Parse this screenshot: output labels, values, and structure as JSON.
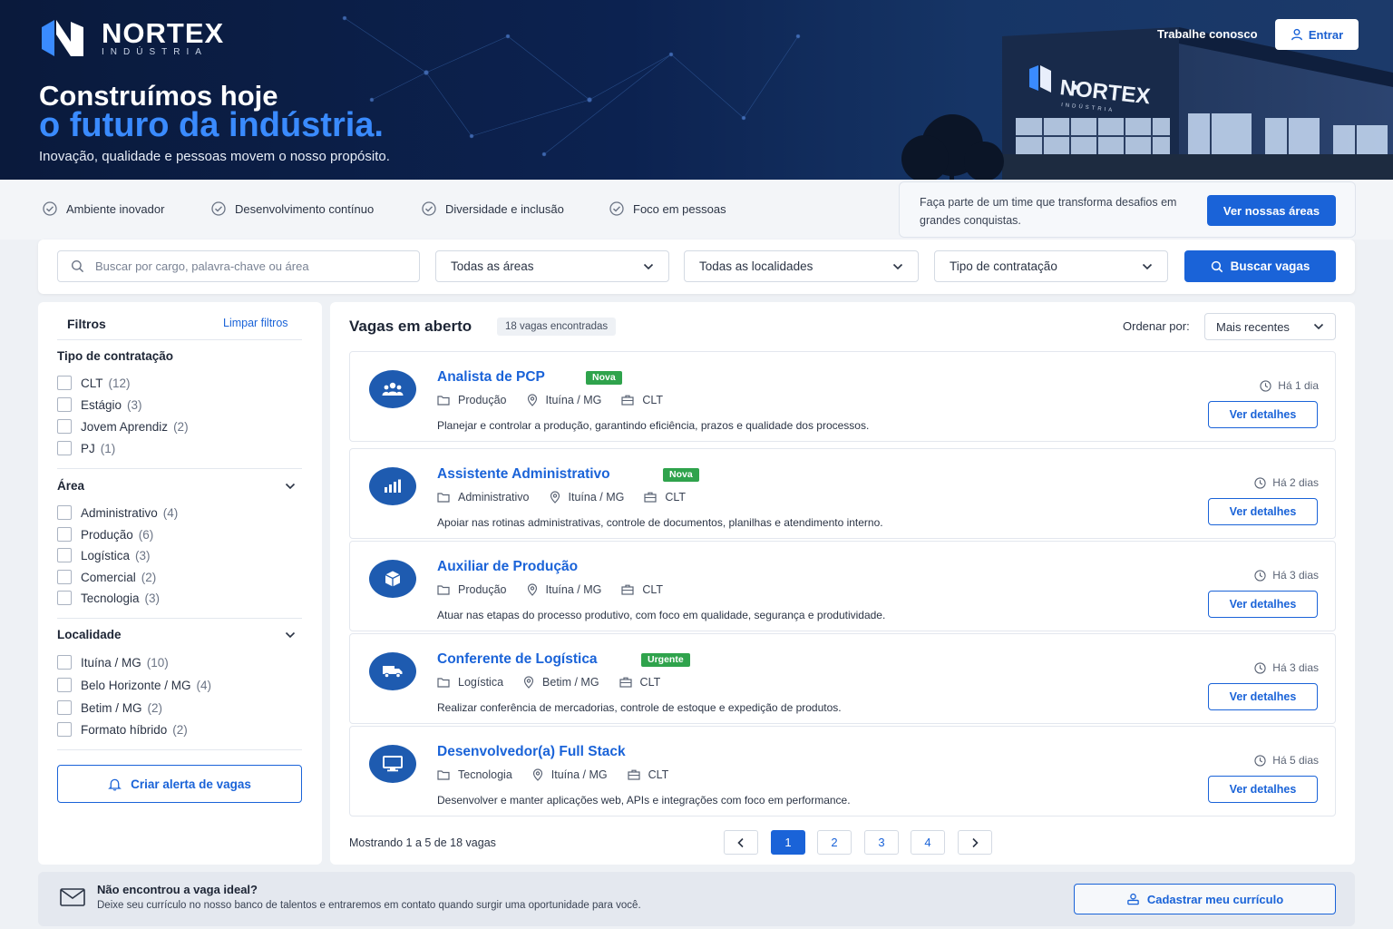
{
  "brand": {
    "name": "NORTEX",
    "sub": "INDÚSTRIA",
    "building_sign": "NORTEX",
    "building_sign_sub": "INDÚSTRIA"
  },
  "hero": {
    "line1": "Construímos hoje",
    "line2": "o futuro da indústria.",
    "tagline": "Inovação, qualidade e pessoas movem o nosso propósito."
  },
  "nav": {
    "work_with_us": "Trabalhe conosco",
    "login": "Entrar"
  },
  "features": [
    "Ambiente inovador",
    "Desenvolvimento contínuo",
    "Diversidade e inclusão",
    "Foco em pessoas"
  ],
  "join": {
    "text": "Faça parte de um time que transforma desafios em grandes conquistas.",
    "button": "Ver nossas áreas"
  },
  "search": {
    "placeholder": "Buscar por cargo, palavra-chave ou área",
    "area": "Todas as áreas",
    "location": "Todas as localidades",
    "contract": "Tipo de contratação",
    "button": "Buscar vagas"
  },
  "filters": {
    "title": "Filtros",
    "clear": "Limpar filtros",
    "contract": {
      "title": "Tipo de contratação",
      "items": [
        {
          "label": "CLT",
          "count": "(12)"
        },
        {
          "label": "Estágio",
          "count": "(3)"
        },
        {
          "label": "Jovem Aprendiz",
          "count": "(2)"
        },
        {
          "label": "PJ",
          "count": "(1)"
        }
      ]
    },
    "area": {
      "title": "Área",
      "items": [
        {
          "label": "Administrativo",
          "count": "(4)"
        },
        {
          "label": "Produção",
          "count": "(6)"
        },
        {
          "label": "Logística",
          "count": "(3)"
        },
        {
          "label": "Comercial",
          "count": "(2)"
        },
        {
          "label": "Tecnologia",
          "count": "(3)"
        }
      ]
    },
    "location": {
      "title": "Localidade",
      "items": [
        {
          "label": "Ituína / MG",
          "count": "(10)"
        },
        {
          "label": "Belo Horizonte / MG",
          "count": "(4)"
        },
        {
          "label": "Betim / MG",
          "count": "(2)"
        },
        {
          "label": "Formato híbrido",
          "count": "(2)"
        }
      ]
    },
    "alert_button": "Criar alerta de vagas"
  },
  "jobs": {
    "title": "Vagas em aberto",
    "count": "18 vagas encontradas",
    "sort_label": "Ordenar por:",
    "sort_value": "Mais recentes",
    "details_label": "Ver detalhes",
    "items": [
      {
        "title": "Analista de PCP",
        "badge": "Nova",
        "badge_color": "#2fa34c",
        "area": "Produção",
        "location": "Ituína / MG",
        "contract": "CLT",
        "desc": "Planejar e controlar a produção, garantindo eficiência, prazos e qualidade dos processos.",
        "time": "Há 1 dia",
        "icon": "team-icon"
      },
      {
        "title": "Assistente Administrativo",
        "badge": "Nova",
        "badge_color": "#2fa34c",
        "area": "Administrativo",
        "location": "Ituína / MG",
        "contract": "CLT",
        "desc": "Apoiar nas rotinas administrativas, controle de documentos, planilhas e atendimento interno.",
        "time": "Há 2 dias",
        "icon": "bar-chart-icon"
      },
      {
        "title": "Auxiliar de Produção",
        "badge": "",
        "badge_color": "",
        "area": "Produção",
        "location": "Ituína / MG",
        "contract": "CLT",
        "desc": "Atuar nas etapas do processo produtivo, com foco em qualidade, segurança e produtividade.",
        "time": "Há 3 dias",
        "icon": "box-icon"
      },
      {
        "title": "Conferente de Logística",
        "badge": "Urgente",
        "badge_color": "#2fa34c",
        "area": "Logística",
        "location": "Betim / MG",
        "contract": "CLT",
        "desc": "Realizar conferência de mercadorias, controle de estoque e expedição de produtos.",
        "time": "Há 3 dias",
        "icon": "truck-icon"
      },
      {
        "title": "Desenvolvedor(a) Full Stack",
        "badge": "",
        "badge_color": "",
        "area": "Tecnologia",
        "location": "Ituína / MG",
        "contract": "CLT",
        "desc": "Desenvolver e manter aplicações web, APIs e integrações com foco em performance.",
        "time": "Há 5 dias",
        "icon": "monitor-icon"
      }
    ]
  },
  "pagination": {
    "showing": "Mostrando 1 a 5 de 18 vagas",
    "pages": [
      "1",
      "2",
      "3",
      "4"
    ],
    "current": "1"
  },
  "bottom": {
    "title": "Não encontrou a vaga ideal?",
    "text": "Deixe seu currículo no nosso banco de talentos e entraremos em contato quando surgir uma oportunidade para você.",
    "button": "Cadastrar meu currículo"
  },
  "colors": {
    "primary": "#1a63d8",
    "hero_bg": "#0a1a3c",
    "accent_text": "#3a8bff",
    "badge_green": "#2fa34c"
  }
}
